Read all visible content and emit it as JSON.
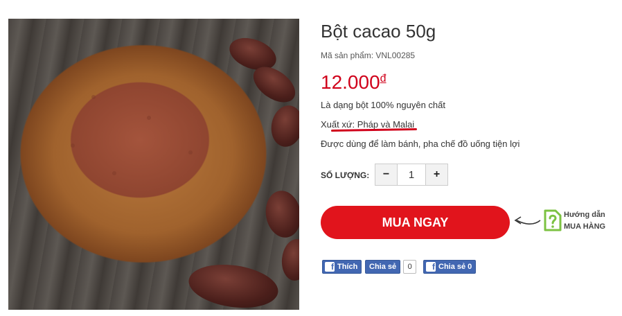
{
  "product": {
    "title": "Bột cacao 50g",
    "sku": "Mã sản phẩm: VNL00285",
    "price": "12.000",
    "currency": "đ",
    "features": [
      "Là dạng bột 100% nguyên chất",
      "Xuất xứ: Pháp và Malai",
      "Được dùng để làm bánh, pha chế đồ uống tiện lợi"
    ]
  },
  "quantity": {
    "label": "SỐ LƯỢNG:",
    "minus": "−",
    "value": "1",
    "plus": "+"
  },
  "buy": {
    "label": "MUA NGAY"
  },
  "guide": {
    "line1": "Hướng dẫn",
    "line2": "MUA HÀNG"
  },
  "social": {
    "like_label": "Thích",
    "share_label": "Chia sẻ",
    "share_count": "0",
    "share_label2": "Chia sẻ 0"
  },
  "colors": {
    "accent": "#e1141c",
    "price": "#d0021b",
    "facebook": "#4267b2"
  }
}
